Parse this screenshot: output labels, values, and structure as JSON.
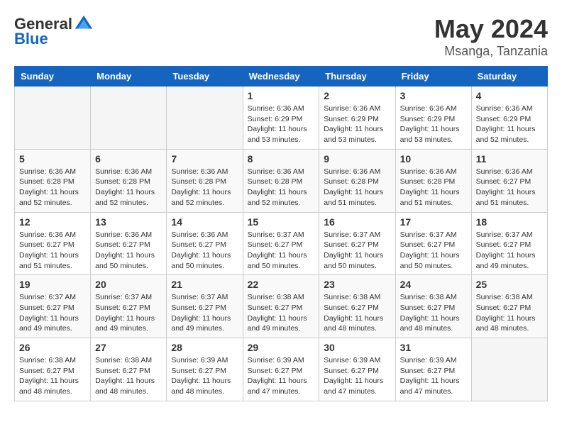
{
  "header": {
    "logo_general": "General",
    "logo_blue": "Blue",
    "month_year": "May 2024",
    "location": "Msanga, Tanzania"
  },
  "weekdays": [
    "Sunday",
    "Monday",
    "Tuesday",
    "Wednesday",
    "Thursday",
    "Friday",
    "Saturday"
  ],
  "weeks": [
    [
      {
        "day": "",
        "info": ""
      },
      {
        "day": "",
        "info": ""
      },
      {
        "day": "",
        "info": ""
      },
      {
        "day": "1",
        "info": "Sunrise: 6:36 AM\nSunset: 6:29 PM\nDaylight: 11 hours\nand 53 minutes."
      },
      {
        "day": "2",
        "info": "Sunrise: 6:36 AM\nSunset: 6:29 PM\nDaylight: 11 hours\nand 53 minutes."
      },
      {
        "day": "3",
        "info": "Sunrise: 6:36 AM\nSunset: 6:29 PM\nDaylight: 11 hours\nand 53 minutes."
      },
      {
        "day": "4",
        "info": "Sunrise: 6:36 AM\nSunset: 6:29 PM\nDaylight: 11 hours\nand 52 minutes."
      }
    ],
    [
      {
        "day": "5",
        "info": "Sunrise: 6:36 AM\nSunset: 6:28 PM\nDaylight: 11 hours\nand 52 minutes."
      },
      {
        "day": "6",
        "info": "Sunrise: 6:36 AM\nSunset: 6:28 PM\nDaylight: 11 hours\nand 52 minutes."
      },
      {
        "day": "7",
        "info": "Sunrise: 6:36 AM\nSunset: 6:28 PM\nDaylight: 11 hours\nand 52 minutes."
      },
      {
        "day": "8",
        "info": "Sunrise: 6:36 AM\nSunset: 6:28 PM\nDaylight: 11 hours\nand 52 minutes."
      },
      {
        "day": "9",
        "info": "Sunrise: 6:36 AM\nSunset: 6:28 PM\nDaylight: 11 hours\nand 51 minutes."
      },
      {
        "day": "10",
        "info": "Sunrise: 6:36 AM\nSunset: 6:28 PM\nDaylight: 11 hours\nand 51 minutes."
      },
      {
        "day": "11",
        "info": "Sunrise: 6:36 AM\nSunset: 6:27 PM\nDaylight: 11 hours\nand 51 minutes."
      }
    ],
    [
      {
        "day": "12",
        "info": "Sunrise: 6:36 AM\nSunset: 6:27 PM\nDaylight: 11 hours\nand 51 minutes."
      },
      {
        "day": "13",
        "info": "Sunrise: 6:36 AM\nSunset: 6:27 PM\nDaylight: 11 hours\nand 50 minutes."
      },
      {
        "day": "14",
        "info": "Sunrise: 6:36 AM\nSunset: 6:27 PM\nDaylight: 11 hours\nand 50 minutes."
      },
      {
        "day": "15",
        "info": "Sunrise: 6:37 AM\nSunset: 6:27 PM\nDaylight: 11 hours\nand 50 minutes."
      },
      {
        "day": "16",
        "info": "Sunrise: 6:37 AM\nSunset: 6:27 PM\nDaylight: 11 hours\nand 50 minutes."
      },
      {
        "day": "17",
        "info": "Sunrise: 6:37 AM\nSunset: 6:27 PM\nDaylight: 11 hours\nand 50 minutes."
      },
      {
        "day": "18",
        "info": "Sunrise: 6:37 AM\nSunset: 6:27 PM\nDaylight: 11 hours\nand 49 minutes."
      }
    ],
    [
      {
        "day": "19",
        "info": "Sunrise: 6:37 AM\nSunset: 6:27 PM\nDaylight: 11 hours\nand 49 minutes."
      },
      {
        "day": "20",
        "info": "Sunrise: 6:37 AM\nSunset: 6:27 PM\nDaylight: 11 hours\nand 49 minutes."
      },
      {
        "day": "21",
        "info": "Sunrise: 6:37 AM\nSunset: 6:27 PM\nDaylight: 11 hours\nand 49 minutes."
      },
      {
        "day": "22",
        "info": "Sunrise: 6:38 AM\nSunset: 6:27 PM\nDaylight: 11 hours\nand 49 minutes."
      },
      {
        "day": "23",
        "info": "Sunrise: 6:38 AM\nSunset: 6:27 PM\nDaylight: 11 hours\nand 48 minutes."
      },
      {
        "day": "24",
        "info": "Sunrise: 6:38 AM\nSunset: 6:27 PM\nDaylight: 11 hours\nand 48 minutes."
      },
      {
        "day": "25",
        "info": "Sunrise: 6:38 AM\nSunset: 6:27 PM\nDaylight: 11 hours\nand 48 minutes."
      }
    ],
    [
      {
        "day": "26",
        "info": "Sunrise: 6:38 AM\nSunset: 6:27 PM\nDaylight: 11 hours\nand 48 minutes."
      },
      {
        "day": "27",
        "info": "Sunrise: 6:38 AM\nSunset: 6:27 PM\nDaylight: 11 hours\nand 48 minutes."
      },
      {
        "day": "28",
        "info": "Sunrise: 6:39 AM\nSunset: 6:27 PM\nDaylight: 11 hours\nand 48 minutes."
      },
      {
        "day": "29",
        "info": "Sunrise: 6:39 AM\nSunset: 6:27 PM\nDaylight: 11 hours\nand 47 minutes."
      },
      {
        "day": "30",
        "info": "Sunrise: 6:39 AM\nSunset: 6:27 PM\nDaylight: 11 hours\nand 47 minutes."
      },
      {
        "day": "31",
        "info": "Sunrise: 6:39 AM\nSunset: 6:27 PM\nDaylight: 11 hours\nand 47 minutes."
      },
      {
        "day": "",
        "info": ""
      }
    ]
  ]
}
